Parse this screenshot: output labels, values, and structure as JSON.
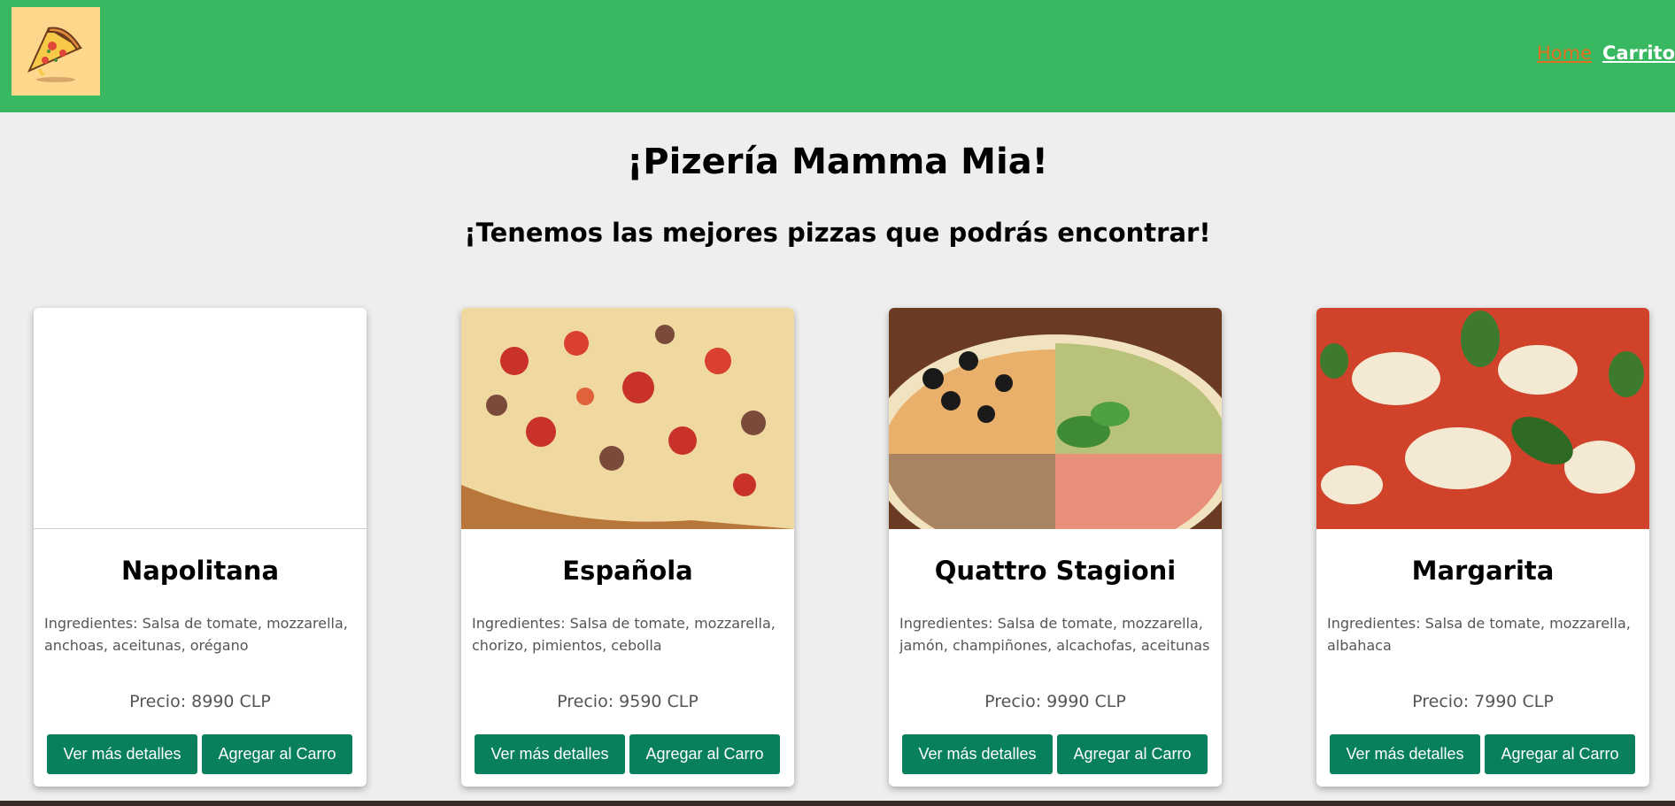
{
  "nav": {
    "logo_alt": "pizza-logo",
    "home_label": "Home",
    "cart_label": "Carrito"
  },
  "header": {
    "title": "¡Pizería Mamma Mia!",
    "subtitle": "¡Tenemos las mejores pizzas que podrás encontrar!"
  },
  "pizzas": [
    {
      "name": "Napolitana",
      "ingredients": "Ingredientes: Salsa de tomate, mozzarella, anchoas, aceitunas, orégano",
      "price": "Precio: 8990 CLP",
      "details_label": "Ver más detalles",
      "add_label": "Agregar al Carro"
    },
    {
      "name": "Española",
      "ingredients": "Ingredientes: Salsa de tomate, mozzarella, chorizo, pimientos, cebolla",
      "price": "Precio: 9590 CLP",
      "details_label": "Ver más detalles",
      "add_label": "Agregar al Carro"
    },
    {
      "name": "Quattro Stagioni",
      "ingredients": "Ingredientes: Salsa de tomate, mozzarella, jamón, champiñones, alcachofas, aceitunas",
      "price": "Precio: 9990 CLP",
      "details_label": "Ver más detalles",
      "add_label": "Agregar al Carro"
    },
    {
      "name": "Margarita",
      "ingredients": "Ingredientes: Salsa de tomate, mozzarella, albahaca",
      "price": "Precio: 7990 CLP",
      "details_label": "Ver más detalles",
      "add_label": "Agregar al Carro"
    }
  ],
  "colors": {
    "navbar": "#39b862",
    "button": "#08805e",
    "home_link": "#e07020"
  }
}
